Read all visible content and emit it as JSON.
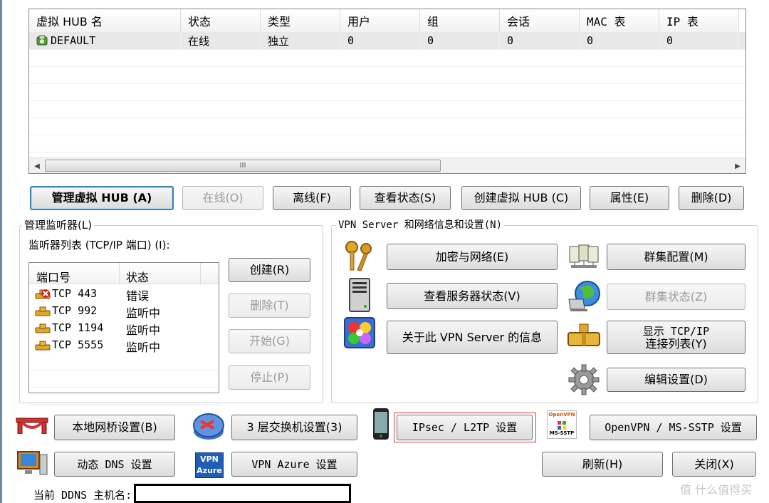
{
  "hub_table": {
    "columns": [
      "虚拟 HUB 名",
      "状态",
      "类型",
      "用户",
      "组",
      "会话",
      "MAC 表",
      "IP 表"
    ],
    "rows": [
      {
        "name": "DEFAULT",
        "status": "在线",
        "type": "独立",
        "users": "0",
        "groups": "0",
        "sessions": "0",
        "mac_table": "0",
        "ip_table": "0"
      }
    ],
    "scrollbar_thumb_glyph": "III"
  },
  "hub_buttons": {
    "manage": "管理虚拟 HUB (A)",
    "online": "在线(O)",
    "offline": "离线(F)",
    "view_status": "查看状态(S)",
    "create_hub": "创建虚拟 HUB (C)",
    "properties": "属性(E)",
    "delete": "删除(D)"
  },
  "listener_group": {
    "title": "管理监听器(L)",
    "list_label": "监听器列表 (TCP/IP 端口) (I):",
    "columns": [
      "端口号",
      "状态"
    ],
    "rows": [
      {
        "port": "TCP 443",
        "status": "错误",
        "icon": "port-error-icon"
      },
      {
        "port": "TCP 992",
        "status": "监听中",
        "icon": "port-listening-icon"
      },
      {
        "port": "TCP 1194",
        "status": "监听中",
        "icon": "port-listening-icon"
      },
      {
        "port": "TCP 5555",
        "status": "监听中",
        "icon": "port-listening-icon"
      }
    ],
    "buttons": {
      "create": "创建(R)",
      "delete": "删除(T)",
      "start": "开始(G)",
      "stop": "停止(P)"
    }
  },
  "vpn_group": {
    "title": "VPN Server 和网络信息和设置(N)",
    "buttons": {
      "encryption": "加密与网络(E)",
      "server_status": "查看服务器状态(V)",
      "about": "关于此 VPN Server 的信息",
      "cluster_config": "群集配置(M)",
      "cluster_status": "群集状态(Z)",
      "tcp_list_line1": "显示 TCP/IP",
      "tcp_list_line2": "连接列表(Y)",
      "edit_config": "编辑设置(D)"
    }
  },
  "bottom": {
    "local_bridge": "本地网桥设置(B)",
    "l3_switch": "3 层交换机设置(3)",
    "ipsec": "IPsec / L2TP 设置",
    "openvpn": "OpenVPN / MS-SSTP 设置",
    "ddns": "动态 DNS 设置",
    "azure": "VPN Azure 设置",
    "refresh": "刷新(H)",
    "close": "关闭(X)",
    "ddns_label": "当前 DDNS 主机名:",
    "ddns_value": "",
    "openvpn_icon_top": "OpenVPN",
    "openvpn_icon_bottom": "MS-SSTP",
    "azure_icon_top": "VPN",
    "azure_icon_bottom": "Azure"
  },
  "watermark": "值 什么值得买",
  "colors": {
    "accent": "#3c7fb1",
    "highlight_box": "#e0393b",
    "error": "#d91f1f"
  }
}
